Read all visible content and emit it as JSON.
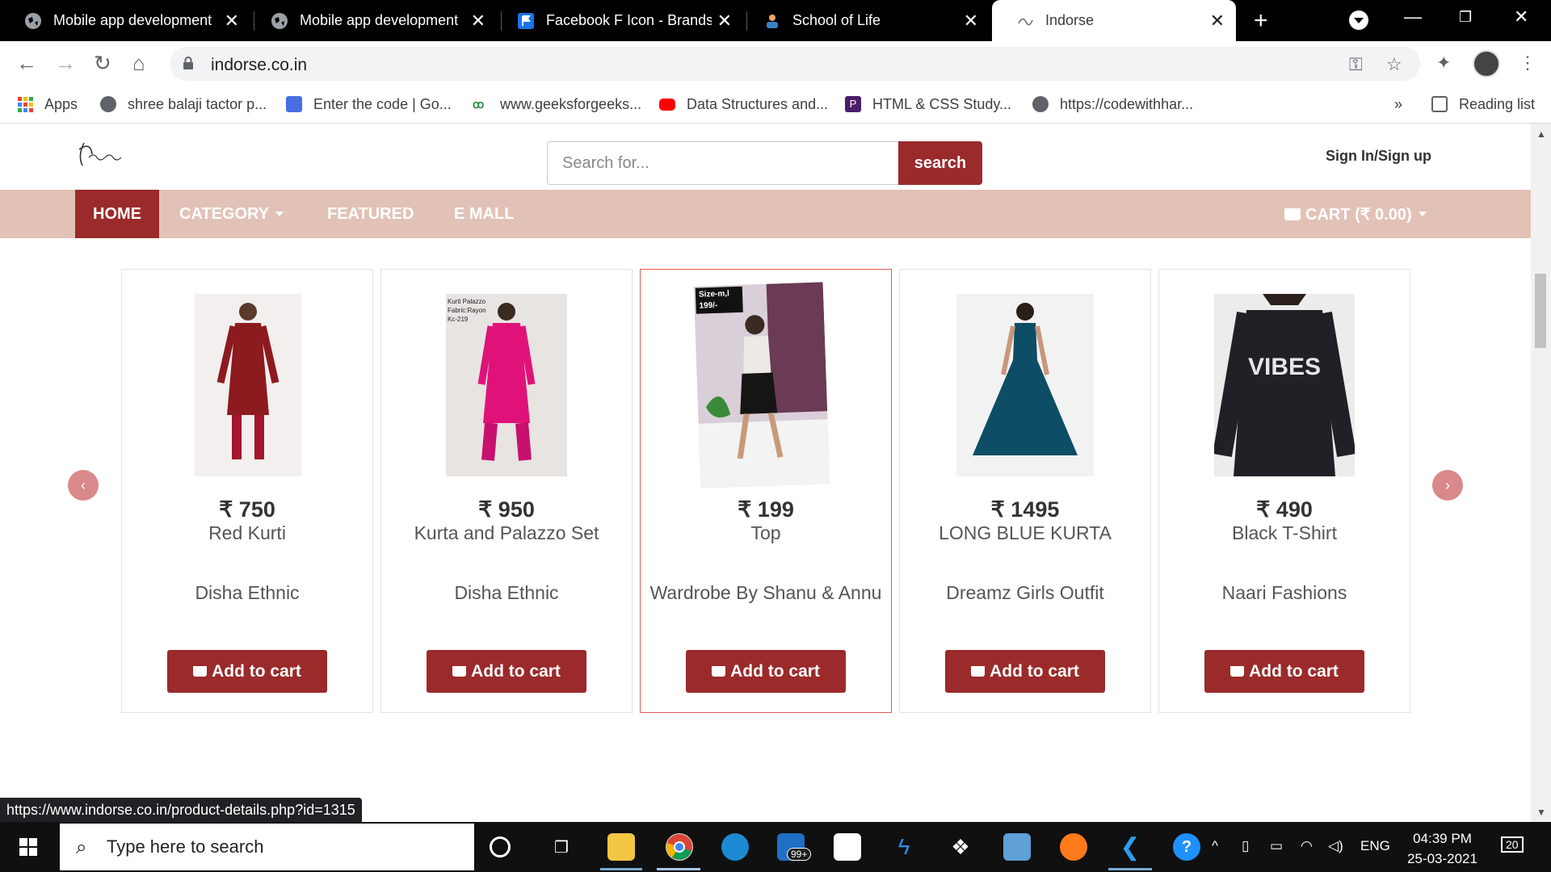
{
  "browser": {
    "tabs": [
      {
        "title": "Mobile app development",
        "icon": "globe-icon"
      },
      {
        "title": "Mobile app development",
        "icon": "globe-icon"
      },
      {
        "title": "Facebook F Icon - Brands",
        "icon": "flag-icon"
      },
      {
        "title": "School of Life",
        "icon": "person-icon"
      },
      {
        "title": "Indorse",
        "icon": "indorse-icon",
        "active": true
      }
    ],
    "url": "indorse.co.in",
    "bookmarks": [
      {
        "label": "Apps",
        "icon": "apps-grid-icon"
      },
      {
        "label": "shree balaji tactor p...",
        "icon": "globe-icon"
      },
      {
        "label": "Enter the code | Go...",
        "icon": "meet-icon"
      },
      {
        "label": "www.geeksforgeeks...",
        "icon": "gfg-icon"
      },
      {
        "label": "Data Structures and...",
        "icon": "youtube-icon"
      },
      {
        "label": "HTML & CSS Study...",
        "icon": "p-icon"
      },
      {
        "label": "https://codewithhar...",
        "icon": "globe-icon"
      }
    ],
    "overflow_label": "»",
    "reading_list": "Reading list",
    "status_url": "https://www.indorse.co.in/product-details.php?id=1315"
  },
  "site": {
    "logo_text": "Indorse",
    "search_placeholder": "Search for...",
    "search_button": "search",
    "signin": "Sign In/Sign up",
    "menu": [
      {
        "label": "HOME",
        "active": true
      },
      {
        "label": "CATEGORY",
        "dropdown": true
      },
      {
        "label": "FEATURED"
      },
      {
        "label": "E MALL"
      }
    ],
    "cart": "CART (₹ 0.00)",
    "carousel_prev": "‹",
    "carousel_next": "›",
    "products": [
      {
        "price": "₹ 750",
        "name": "Red Kurti",
        "seller": "Disha Ethnic",
        "button": "Add to cart",
        "color": "#8c1a1f"
      },
      {
        "price": "₹ 950",
        "name": "Kurta and Palazzo Set",
        "seller": "Disha Ethnic",
        "button": "Add to cart",
        "color": "#e0127a"
      },
      {
        "price": "₹ 199",
        "name": "Top",
        "seller": "Wardrobe By Shanu & Annu",
        "button": "Add to cart",
        "color": "#222222",
        "badge": "Size-m,l 199/-"
      },
      {
        "price": "₹ 1495",
        "name": "LONG BLUE KURTA",
        "seller": "Dreamz Girls Outfit",
        "button": "Add to cart",
        "color": "#0d4d66"
      },
      {
        "price": "₹ 490",
        "name": "Black T-Shirt",
        "seller": "Naari Fashions",
        "button": "Add to cart",
        "color": "#231f26",
        "print": "VIBES"
      }
    ],
    "image2_caption": "Kurti Palazzo Fabric:Rayon Kc-219"
  },
  "taskbar": {
    "search_placeholder": "Type here to search",
    "mail_badge": "99+",
    "lang": "ENG",
    "time": "04:39 PM",
    "date": "25-03-2021",
    "notifications": "20"
  },
  "colors": {
    "accent": "#9b2a2b",
    "menubar": "#e2c2b7"
  }
}
